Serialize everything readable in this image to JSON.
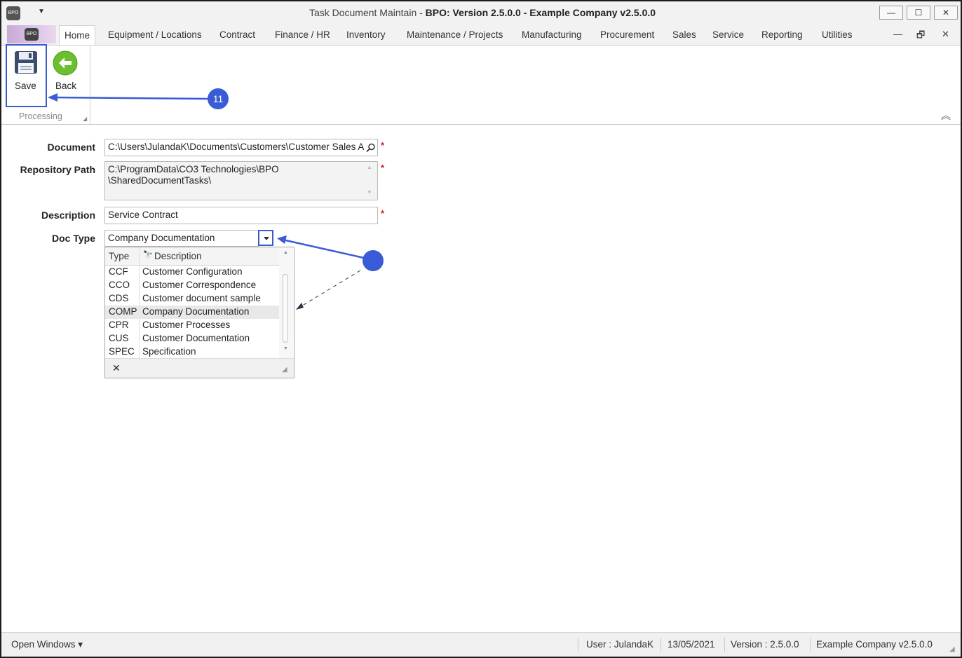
{
  "window": {
    "title_prefix": "Task Document Maintain - ",
    "title_bold": "BPO: Version 2.5.0.0 - Example Company v2.5.0.0",
    "app_icon_text": "BPO",
    "minimize": "—",
    "maximize": "☐",
    "close": "✕"
  },
  "ribbon": {
    "tabs": [
      "Home",
      "Equipment / Locations",
      "Contract",
      "Finance / HR",
      "Inventory",
      "Maintenance / Projects",
      "Manufacturing",
      "Procurement",
      "Sales",
      "Service",
      "Reporting",
      "Utilities"
    ],
    "mdi_controls": [
      "—",
      "🗗",
      "✕"
    ],
    "save_label": "Save",
    "back_label": "Back",
    "group_label": "Processing"
  },
  "form": {
    "document_label": "Document",
    "document_value": "C:\\Users\\JulandaK\\Documents\\Customers\\Customer Sales A",
    "repository_label": "Repository Path",
    "repository_value": "C:\\ProgramData\\CO3 Technologies\\BPO \\SharedDocumentTasks\\",
    "description_label": "Description",
    "description_value": "Service Contract",
    "doctype_label": "Doc Type",
    "doctype_value": "Company Documentation",
    "required_mark": "*"
  },
  "lookup": {
    "columns": [
      "Type",
      "Description"
    ],
    "rows": [
      {
        "type": "CCF",
        "description": "Customer Configuration"
      },
      {
        "type": "CCO",
        "description": "Customer Correspondence"
      },
      {
        "type": "CDS",
        "description": "Customer document sample"
      },
      {
        "type": "COMP",
        "description": "Company Documentation"
      },
      {
        "type": "CPR",
        "description": "Customer Processes"
      },
      {
        "type": "CUS",
        "description": "Customer Documentation"
      },
      {
        "type": "SPEC",
        "description": "Specification"
      }
    ],
    "selected_type": "COMP",
    "close_glyph": "✕"
  },
  "annotations": {
    "step_badge": "11",
    "accent_color": "#3a5bd6"
  },
  "status": {
    "open_windows": "Open Windows ▾",
    "user": "User : JulandaK",
    "date": "13/05/2021",
    "version": "Version : 2.5.0.0",
    "company": "Example Company v2.5.0.0"
  }
}
